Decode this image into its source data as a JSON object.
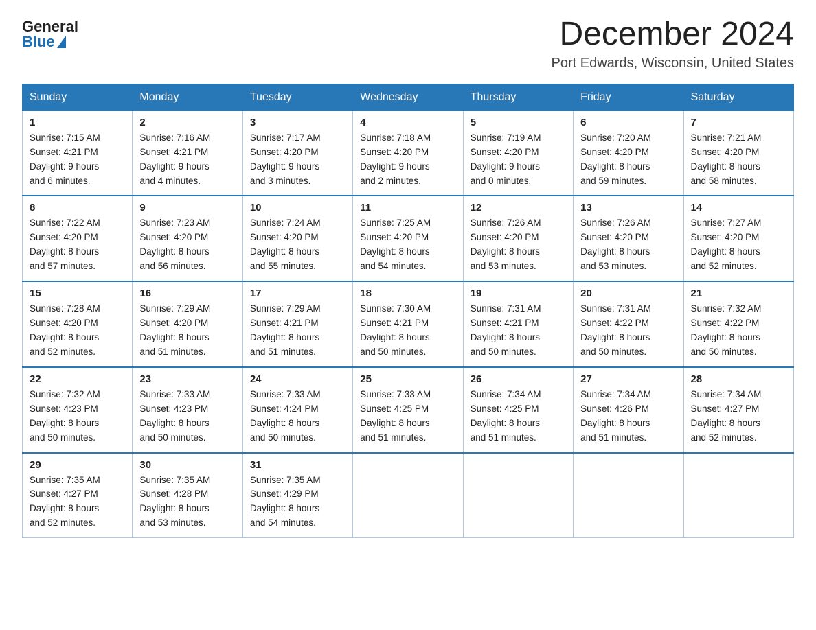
{
  "logo": {
    "general": "General",
    "blue": "Blue"
  },
  "title": "December 2024",
  "subtitle": "Port Edwards, Wisconsin, United States",
  "weekdays": [
    "Sunday",
    "Monday",
    "Tuesday",
    "Wednesday",
    "Thursday",
    "Friday",
    "Saturday"
  ],
  "weeks": [
    [
      {
        "day": "1",
        "sunrise": "7:15 AM",
        "sunset": "4:21 PM",
        "daylight": "9 hours and 6 minutes."
      },
      {
        "day": "2",
        "sunrise": "7:16 AM",
        "sunset": "4:21 PM",
        "daylight": "9 hours and 4 minutes."
      },
      {
        "day": "3",
        "sunrise": "7:17 AM",
        "sunset": "4:20 PM",
        "daylight": "9 hours and 3 minutes."
      },
      {
        "day": "4",
        "sunrise": "7:18 AM",
        "sunset": "4:20 PM",
        "daylight": "9 hours and 2 minutes."
      },
      {
        "day": "5",
        "sunrise": "7:19 AM",
        "sunset": "4:20 PM",
        "daylight": "9 hours and 0 minutes."
      },
      {
        "day": "6",
        "sunrise": "7:20 AM",
        "sunset": "4:20 PM",
        "daylight": "8 hours and 59 minutes."
      },
      {
        "day": "7",
        "sunrise": "7:21 AM",
        "sunset": "4:20 PM",
        "daylight": "8 hours and 58 minutes."
      }
    ],
    [
      {
        "day": "8",
        "sunrise": "7:22 AM",
        "sunset": "4:20 PM",
        "daylight": "8 hours and 57 minutes."
      },
      {
        "day": "9",
        "sunrise": "7:23 AM",
        "sunset": "4:20 PM",
        "daylight": "8 hours and 56 minutes."
      },
      {
        "day": "10",
        "sunrise": "7:24 AM",
        "sunset": "4:20 PM",
        "daylight": "8 hours and 55 minutes."
      },
      {
        "day": "11",
        "sunrise": "7:25 AM",
        "sunset": "4:20 PM",
        "daylight": "8 hours and 54 minutes."
      },
      {
        "day": "12",
        "sunrise": "7:26 AM",
        "sunset": "4:20 PM",
        "daylight": "8 hours and 53 minutes."
      },
      {
        "day": "13",
        "sunrise": "7:26 AM",
        "sunset": "4:20 PM",
        "daylight": "8 hours and 53 minutes."
      },
      {
        "day": "14",
        "sunrise": "7:27 AM",
        "sunset": "4:20 PM",
        "daylight": "8 hours and 52 minutes."
      }
    ],
    [
      {
        "day": "15",
        "sunrise": "7:28 AM",
        "sunset": "4:20 PM",
        "daylight": "8 hours and 52 minutes."
      },
      {
        "day": "16",
        "sunrise": "7:29 AM",
        "sunset": "4:20 PM",
        "daylight": "8 hours and 51 minutes."
      },
      {
        "day": "17",
        "sunrise": "7:29 AM",
        "sunset": "4:21 PM",
        "daylight": "8 hours and 51 minutes."
      },
      {
        "day": "18",
        "sunrise": "7:30 AM",
        "sunset": "4:21 PM",
        "daylight": "8 hours and 50 minutes."
      },
      {
        "day": "19",
        "sunrise": "7:31 AM",
        "sunset": "4:21 PM",
        "daylight": "8 hours and 50 minutes."
      },
      {
        "day": "20",
        "sunrise": "7:31 AM",
        "sunset": "4:22 PM",
        "daylight": "8 hours and 50 minutes."
      },
      {
        "day": "21",
        "sunrise": "7:32 AM",
        "sunset": "4:22 PM",
        "daylight": "8 hours and 50 minutes."
      }
    ],
    [
      {
        "day": "22",
        "sunrise": "7:32 AM",
        "sunset": "4:23 PM",
        "daylight": "8 hours and 50 minutes."
      },
      {
        "day": "23",
        "sunrise": "7:33 AM",
        "sunset": "4:23 PM",
        "daylight": "8 hours and 50 minutes."
      },
      {
        "day": "24",
        "sunrise": "7:33 AM",
        "sunset": "4:24 PM",
        "daylight": "8 hours and 50 minutes."
      },
      {
        "day": "25",
        "sunrise": "7:33 AM",
        "sunset": "4:25 PM",
        "daylight": "8 hours and 51 minutes."
      },
      {
        "day": "26",
        "sunrise": "7:34 AM",
        "sunset": "4:25 PM",
        "daylight": "8 hours and 51 minutes."
      },
      {
        "day": "27",
        "sunrise": "7:34 AM",
        "sunset": "4:26 PM",
        "daylight": "8 hours and 51 minutes."
      },
      {
        "day": "28",
        "sunrise": "7:34 AM",
        "sunset": "4:27 PM",
        "daylight": "8 hours and 52 minutes."
      }
    ],
    [
      {
        "day": "29",
        "sunrise": "7:35 AM",
        "sunset": "4:27 PM",
        "daylight": "8 hours and 52 minutes."
      },
      {
        "day": "30",
        "sunrise": "7:35 AM",
        "sunset": "4:28 PM",
        "daylight": "8 hours and 53 minutes."
      },
      {
        "day": "31",
        "sunrise": "7:35 AM",
        "sunset": "4:29 PM",
        "daylight": "8 hours and 54 minutes."
      },
      null,
      null,
      null,
      null
    ]
  ],
  "labels": {
    "sunrise": "Sunrise:",
    "sunset": "Sunset:",
    "daylight": "Daylight:"
  }
}
